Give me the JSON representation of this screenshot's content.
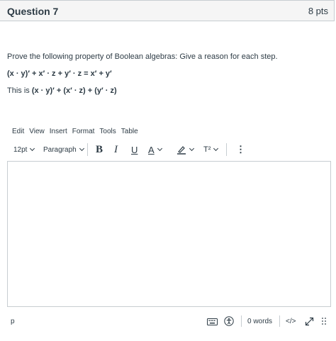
{
  "question": {
    "title": "Question 7",
    "points": "8 pts",
    "prompt": "Prove the following property of Boolean algebras: Give a reason for each step.",
    "expression": "(x · y)′ + x′ · z + y′ · z = x′ + y′",
    "this_is_label": "This is ",
    "this_is_expr": "(x · y)′ + (x′ · z) + (y′ · z)"
  },
  "editor": {
    "menu": [
      "Edit",
      "View",
      "Insert",
      "Format",
      "Tools",
      "Table"
    ],
    "font_size": "12pt",
    "block_format": "Paragraph",
    "bold_label": "B",
    "italic_label": "I",
    "underline_label": "U",
    "text_color_label": "A",
    "superscript_label": "T²",
    "more_label": "⋮",
    "status_path": "p",
    "word_count": "0 words",
    "html_toggle_label": "</>"
  },
  "icons": {
    "keyboard": "keyboard-icon",
    "accessibility": "accessibility-icon",
    "fullscreen": "fullscreen-icon",
    "resize": "resize-handle-icon",
    "highlight": "highlight-color-icon"
  },
  "colors": {
    "text": "#2d3b45",
    "border": "#c7cdd1",
    "header_bg": "#f5f5f5"
  }
}
